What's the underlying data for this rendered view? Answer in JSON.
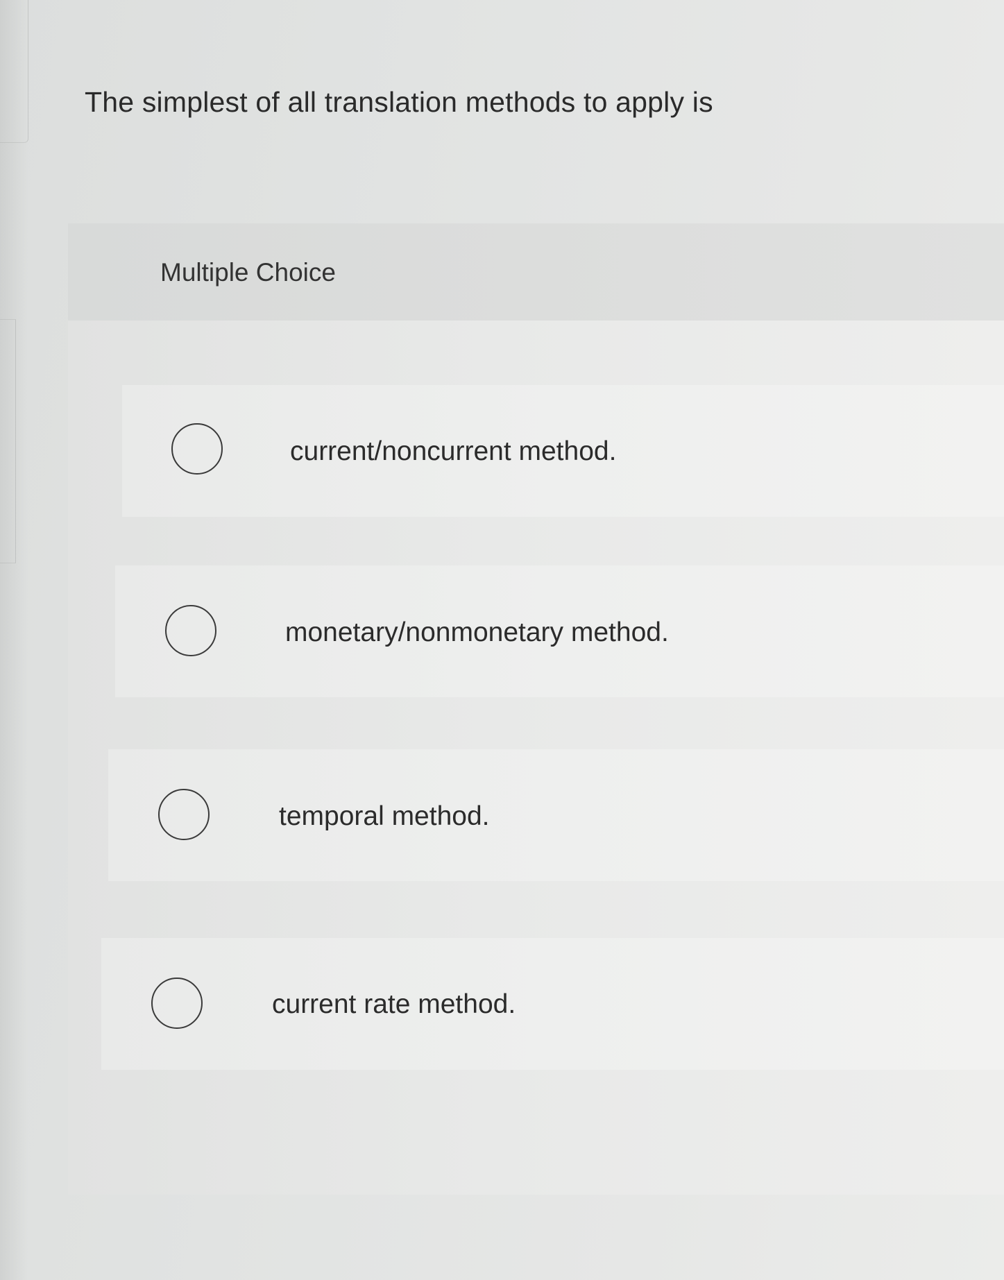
{
  "question": {
    "text": "The simplest of all translation methods to apply is"
  },
  "answer_panel": {
    "label": "Multiple Choice",
    "options": [
      {
        "label": "current/noncurrent method.",
        "selected": false
      },
      {
        "label": "monetary/nonmonetary method.",
        "selected": false
      },
      {
        "label": "temporal method.",
        "selected": false
      },
      {
        "label": "current rate method.",
        "selected": false
      }
    ]
  }
}
